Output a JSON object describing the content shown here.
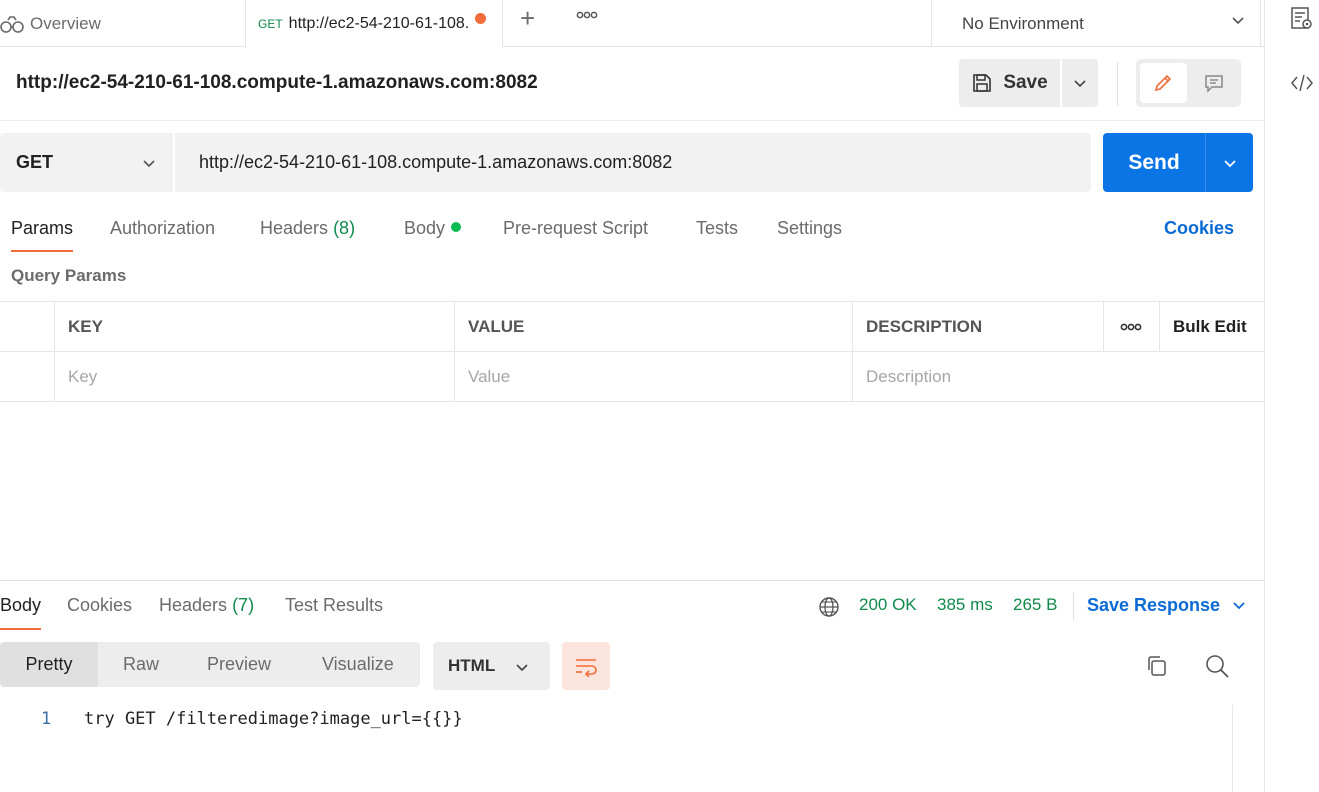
{
  "topbar": {
    "overview_label": "Overview",
    "active_tab": {
      "method": "GET",
      "url": "http://ec2-54-210-61-108.compute-1.amazonaws.com:8082"
    },
    "environment": "No Environment"
  },
  "request": {
    "title": "http://ec2-54-210-61-108.compute-1.amazonaws.com:8082",
    "save_label": "Save",
    "method": "GET",
    "url": "http://ec2-54-210-61-108.compute-1.amazonaws.com:8082",
    "send_label": "Send"
  },
  "request_tabs": {
    "params": "Params",
    "authorization": "Authorization",
    "headers": "Headers",
    "headers_count": "(8)",
    "body": "Body",
    "prerequest": "Pre-request Script",
    "tests": "Tests",
    "settings": "Settings",
    "cookies": "Cookies"
  },
  "query_params": {
    "title": "Query Params",
    "columns": {
      "key": "KEY",
      "value": "VALUE",
      "description": "DESCRIPTION",
      "bulk_edit": "Bulk Edit"
    },
    "placeholders": {
      "key": "Key",
      "value": "Value",
      "description": "Description"
    }
  },
  "response": {
    "tabs": {
      "body": "Body",
      "cookies": "Cookies",
      "headers": "Headers",
      "headers_count": "(7)",
      "test_results": "Test Results"
    },
    "status": "200 OK",
    "time": "385 ms",
    "size": "265 B",
    "save_response": "Save Response",
    "views": {
      "pretty": "Pretty",
      "raw": "Raw",
      "preview": "Preview",
      "visualize": "Visualize"
    },
    "format": "HTML",
    "lines": [
      {
        "number": "1",
        "text": "try GET /filteredimage?image_url={{}}"
      }
    ]
  },
  "colors": {
    "accent_orange": "#f26b3a",
    "send_blue": "#0c75e6",
    "status_green": "#0f8a4a",
    "link_blue": "#0b6ad6"
  }
}
